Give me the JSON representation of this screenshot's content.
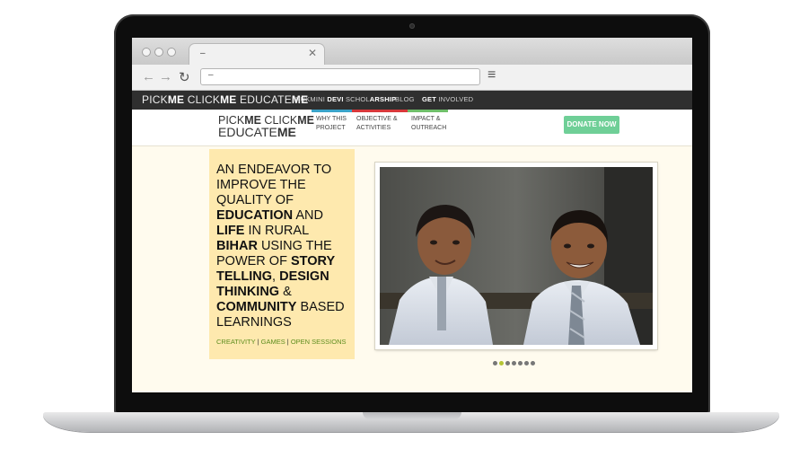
{
  "browser": {
    "tab_title": "–",
    "address": "–",
    "icons": [
      "back-arrow-icon",
      "forward-arrow-icon",
      "reload-icon",
      "menu-icon",
      "close-icon"
    ]
  },
  "topbar": {
    "brand_a": "PICK",
    "brand_b": "ME",
    "brand_c": " CLICK",
    "brand_d": "ME",
    "brand_e": " EDUCATE",
    "brand_f": "ME",
    "links": {
      "scholarship_a": "RUKMINI ",
      "scholarship_b": "DEVI",
      "scholarship_c": " SCHOL",
      "scholarship_d": "ARSHIP",
      "blog": "BLOG",
      "involved_a": "GET",
      "involved_b": " INVOLVED"
    }
  },
  "header": {
    "logo_l1a": "PICK",
    "logo_l1b": "ME",
    "logo_l1c": " CLICK",
    "logo_l1d": "ME",
    "logo_l2a": "EDUCATE",
    "logo_l2b": "ME",
    "nav": [
      {
        "line1": "WHY THIS",
        "line2": "PROJECT",
        "accent": "#3aa3c9"
      },
      {
        "line1": "OBJECTIVE &",
        "line2": "ACTIVITIES",
        "accent": "#d8383b"
      },
      {
        "line1": "IMPACT &",
        "line2": "OUTREACH",
        "accent": "#6fbf6a"
      }
    ],
    "donate_label": "DONATE NOW"
  },
  "hero": {
    "t1": "AN ENDEAVOR TO IMPROVE THE QUALITY OF ",
    "t2": "EDUCATION",
    "t3": " AND ",
    "t4": "LIFE",
    "t5": " IN RURAL ",
    "t6": "BIHAR",
    "t7": " USING THE POWER OF ",
    "t8": "STORY TELLING",
    "t9": ", ",
    "t10": "DESIGN THINKING",
    "t11": " & ",
    "t12": "COMMUNITY",
    "t13": " BASED LEARNINGS",
    "tags": [
      "CREATIVITY",
      "GAMES",
      "OPEN SESSIONS"
    ],
    "tag_sep": " | "
  },
  "slider": {
    "count": 7,
    "active_index": 1
  },
  "colors": {
    "hero_box": "#fee9ae",
    "donate": "#6fcf97",
    "tag_green": "#5d8d1e",
    "topbar": "#2f2f2f"
  }
}
